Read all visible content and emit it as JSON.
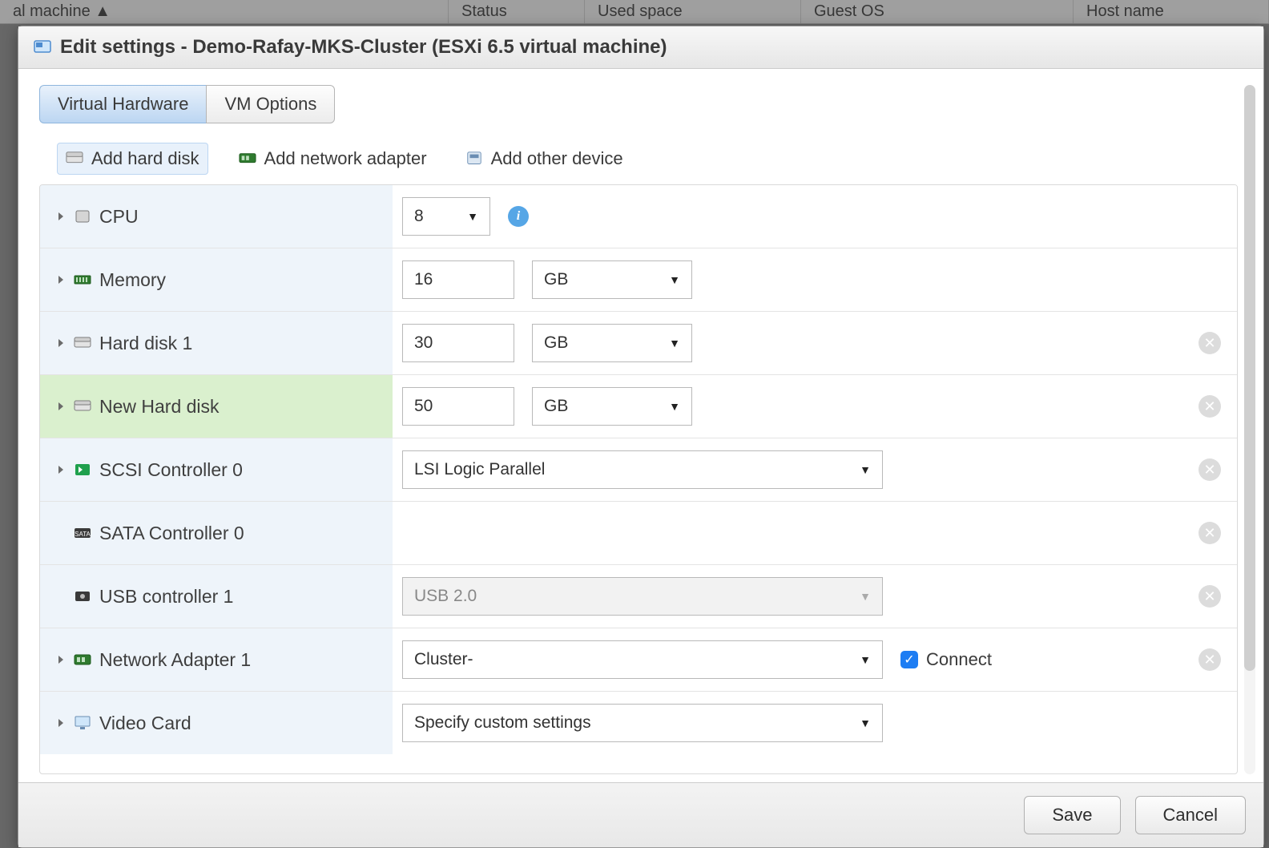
{
  "bg": {
    "cols": [
      "al machine ▲",
      "Status",
      "Used space",
      "Guest OS",
      "Host name"
    ]
  },
  "dialog": {
    "title": "Edit settings - Demo-Rafay-MKS-Cluster (ESXi 6.5 virtual machine)"
  },
  "tabs": {
    "hardware": "Virtual Hardware",
    "options": "VM Options"
  },
  "toolbar": {
    "add_disk": "Add hard disk",
    "add_nic": "Add network adapter",
    "add_other": "Add other device"
  },
  "rows": {
    "cpu": {
      "label": "CPU",
      "value": "8"
    },
    "memory": {
      "label": "Memory",
      "value": "16",
      "unit": "GB"
    },
    "hd1": {
      "label": "Hard disk 1",
      "value": "30",
      "unit": "GB"
    },
    "newhd": {
      "label": "New Hard disk",
      "value": "50",
      "unit": "GB"
    },
    "scsi": {
      "label": "SCSI Controller 0",
      "value": "LSI Logic Parallel"
    },
    "sata": {
      "label": "SATA Controller 0"
    },
    "usb": {
      "label": "USB controller 1",
      "value": "USB 2.0"
    },
    "nic": {
      "label": "Network Adapter 1",
      "value": "Cluster-",
      "connect": "Connect"
    },
    "video": {
      "label": "Video Card",
      "value": "Specify custom settings"
    }
  },
  "footer": {
    "save": "Save",
    "cancel": "Cancel"
  }
}
